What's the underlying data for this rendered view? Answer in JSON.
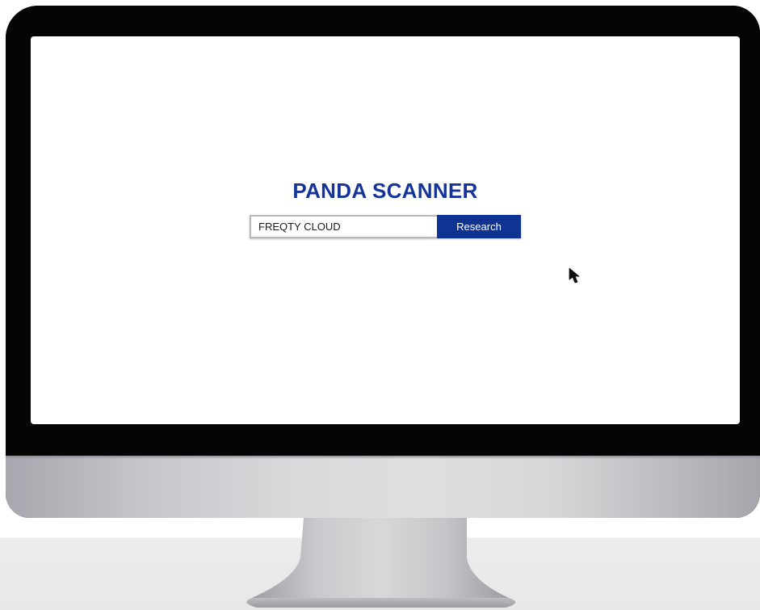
{
  "app": {
    "title": "PANDA SCANNER"
  },
  "search": {
    "value": "FREQTY CLOUD",
    "placeholder": "",
    "button_label": "Research"
  },
  "colors": {
    "brand": "#14349a",
    "button": "#0e3393",
    "bezel": "#050505"
  },
  "icons": {
    "cursor": "mouse-pointer-icon"
  }
}
